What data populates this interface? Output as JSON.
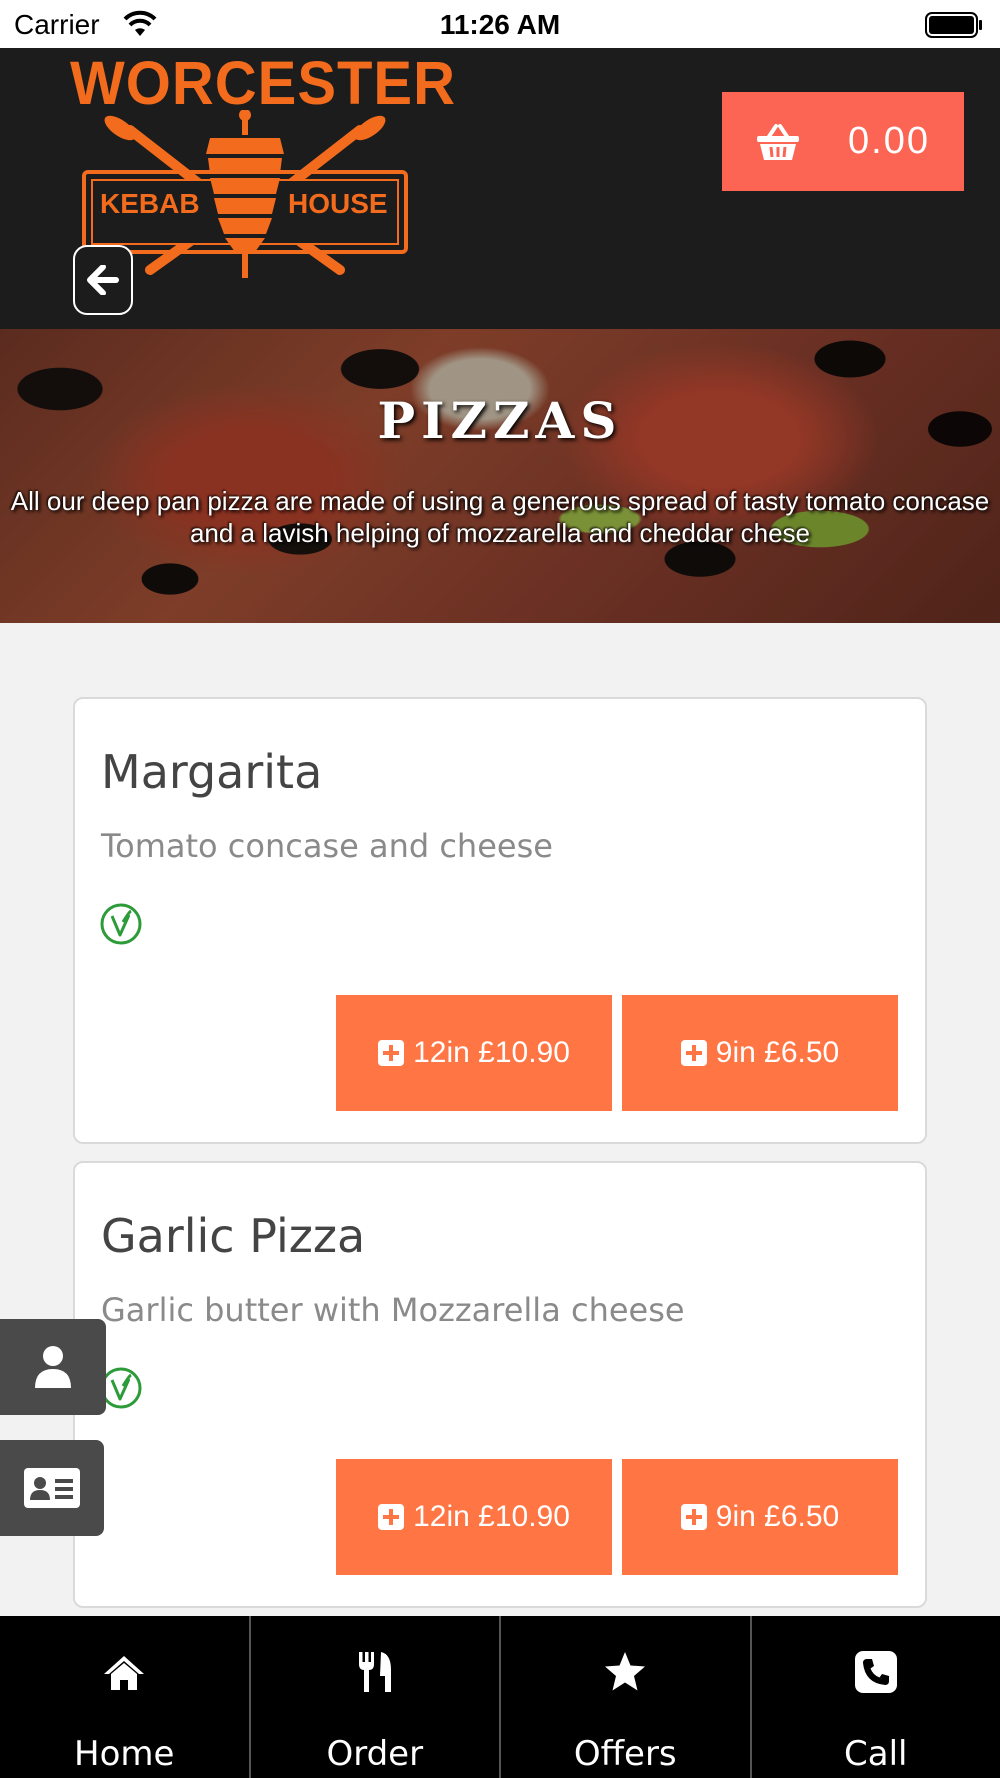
{
  "status_bar": {
    "carrier": "Carrier",
    "time": "11:26 AM"
  },
  "header": {
    "logo": {
      "title": "WORCESTER",
      "left_word": "KEBAB",
      "right_word": "HOUSE"
    },
    "cart_total": "0.00"
  },
  "banner": {
    "title": "PIZZAS",
    "description": "All our deep pan pizza are made of using a generous spread of tasty tomato concase and a lavish helping of mozzarella and cheddar chese"
  },
  "menu_items": [
    {
      "name": "Margarita",
      "description": "Tomato concase and cheese",
      "vegetarian": true,
      "options": [
        {
          "label": "12in £10.90"
        },
        {
          "label": "9in £6.50"
        }
      ]
    },
    {
      "name": "Garlic Pizza",
      "description": "Garlic butter with Mozzarella cheese",
      "vegetarian": true,
      "options": [
        {
          "label": "12in £10.90"
        },
        {
          "label": "9in £6.50"
        }
      ]
    }
  ],
  "side_buttons": [
    {
      "icon": "user-icon"
    },
    {
      "icon": "contact-card-icon"
    }
  ],
  "bottom_nav": [
    {
      "label": "Home",
      "icon": "home-icon"
    },
    {
      "label": "Order",
      "icon": "cutlery-icon"
    },
    {
      "label": "Offers",
      "icon": "star-icon"
    },
    {
      "label": "Call",
      "icon": "phone-icon"
    }
  ],
  "colors": {
    "header_bg": "#1c1c1c",
    "cart_bg": "#fc6453",
    "price_button": "#ff7544",
    "brand_orange": "#f36b1c",
    "veg_green": "#2e9b3a",
    "nav_bg": "#000000"
  }
}
